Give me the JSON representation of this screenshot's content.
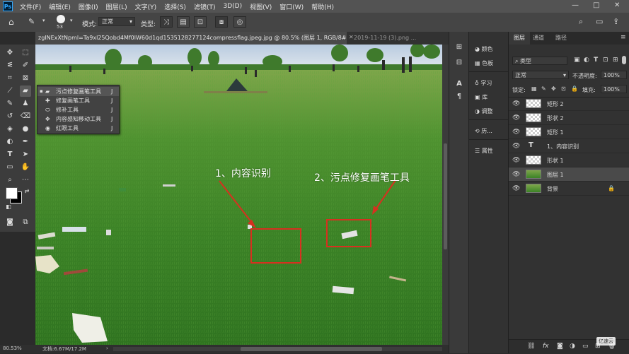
{
  "app": {
    "logo": "Ps"
  },
  "menu": [
    "文件(F)",
    "编辑(E)",
    "图像(I)",
    "图层(L)",
    "文字(Y)",
    "选择(S)",
    "滤镜(T)",
    "3D(D)",
    "视图(V)",
    "窗口(W)",
    "帮助(H)"
  ],
  "window_controls": {
    "minimize": "—",
    "maximize": "□",
    "close": "✕"
  },
  "options": {
    "brush_size": "53",
    "mode_label": "模式:",
    "mode_value": "正常",
    "type_label": "类型:"
  },
  "tabs": [
    {
      "label": "zgINExXtNpml=Ta9xl25Qobd4Mf0lW60d1qd1535128277124compressflag.jpeg.jpg @ 80.5% (图层 1, RGB/8#) *",
      "active": true
    },
    {
      "label": "2019-11-19 (3).png ...",
      "active": false
    }
  ],
  "flyout": {
    "items": [
      {
        "label": "污点修复画笔工具",
        "shortcut": "J",
        "active": true
      },
      {
        "label": "修复画笔工具",
        "shortcut": "J",
        "active": false
      },
      {
        "label": "修补工具",
        "shortcut": "J",
        "active": false
      },
      {
        "label": "内容感知移动工具",
        "shortcut": "J",
        "active": false
      },
      {
        "label": "红眼工具",
        "shortcut": "J",
        "active": false
      }
    ]
  },
  "annotations": {
    "label1": "1、内容识别",
    "label2": "2、污点修复画笔工具",
    "color": "#d7301f"
  },
  "status": {
    "zoom": "80.53%",
    "doc": "文档:6.67M/17.2M"
  },
  "side_panels": {
    "group1": [
      "颜色",
      "色板"
    ],
    "group2": [
      "学习",
      "库",
      "调整"
    ],
    "group3": [
      "历..."
    ],
    "group4": [
      "属性"
    ]
  },
  "layers_panel": {
    "tabs": [
      "图层",
      "通道",
      "路径"
    ],
    "kind_label": "类型",
    "blend_mode": "正常",
    "opacity_label": "不透明度:",
    "opacity_value": "100%",
    "lock_label": "锁定:",
    "fill_label": "填充:",
    "fill_value": "100%",
    "layers": [
      {
        "name": "矩形 2",
        "kind": "shape",
        "selected": false,
        "locked": false
      },
      {
        "name": "形状 2",
        "kind": "shape",
        "selected": false,
        "locked": false
      },
      {
        "name": "矩形 1",
        "kind": "shape",
        "selected": false,
        "locked": false
      },
      {
        "name": "1、内容识别",
        "kind": "text",
        "selected": false,
        "locked": false
      },
      {
        "name": "形状 1",
        "kind": "shape",
        "selected": false,
        "locked": false
      },
      {
        "name": "图层 1",
        "kind": "image",
        "selected": true,
        "locked": false
      },
      {
        "name": "背景",
        "kind": "image",
        "selected": false,
        "locked": true
      }
    ],
    "footer_icons": [
      "link-icon",
      "fx-icon",
      "mask-icon",
      "adjustment-icon",
      "group-icon",
      "new-layer-icon",
      "trash-icon"
    ],
    "footer_fx": "fx"
  },
  "watermark": "亿速云"
}
